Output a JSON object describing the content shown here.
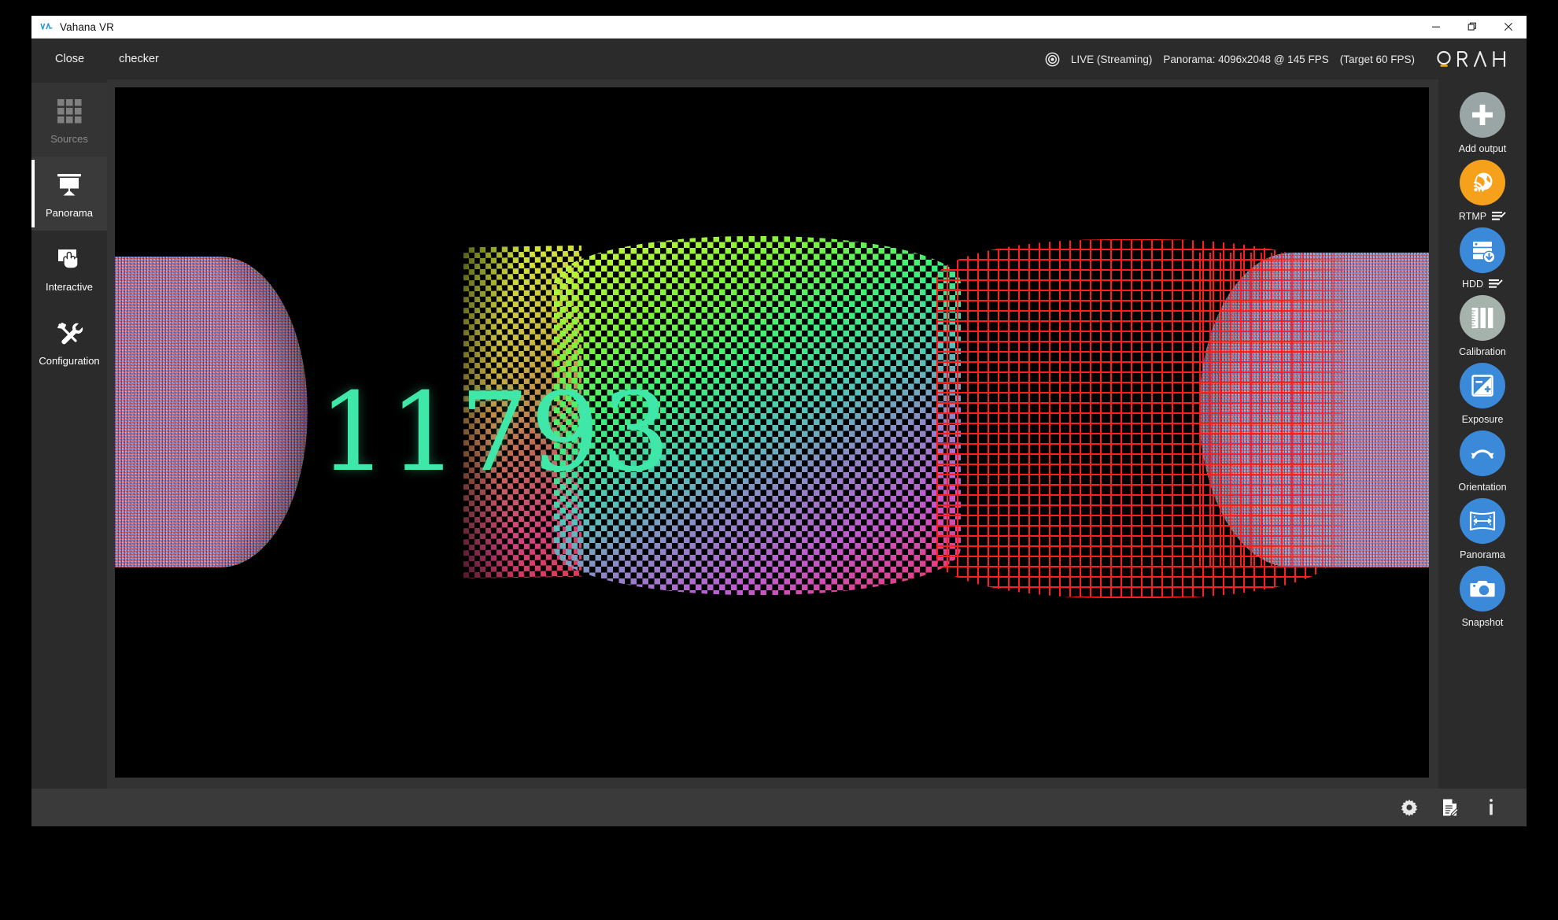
{
  "window": {
    "title": "Vahana VR",
    "logo_icon": "vahana-logo-icon",
    "controls": {
      "minimize": "minimize-icon",
      "restore": "restore-icon",
      "close": "close-icon"
    }
  },
  "header": {
    "close_label": "Close",
    "project_name": "checker",
    "record_icon": "record-target-icon",
    "live_status": "LIVE (Streaming)",
    "panorama_info": "Panorama: 4096x2048 @  145 FPS",
    "target_fps": "(Target 60 FPS)",
    "brand": "ORAH"
  },
  "sidebar": {
    "items": [
      {
        "label": "Sources",
        "icon": "grid-icon",
        "state": "inactive"
      },
      {
        "label": "Panorama",
        "icon": "projector-icon",
        "state": "active"
      },
      {
        "label": "Interactive",
        "icon": "hand-screen-icon",
        "state": "normal"
      },
      {
        "label": "Configuration",
        "icon": "tools-icon",
        "state": "normal"
      }
    ]
  },
  "outputs": {
    "items": [
      {
        "label": "Add output",
        "icon": "plus-icon",
        "color": "#9aa6a6",
        "has_edit": false
      },
      {
        "label": "RTMP",
        "icon": "globe-rss-icon",
        "color": "#f5a11b",
        "has_edit": true
      },
      {
        "label": "HDD",
        "icon": "server-download-icon",
        "color": "#3b8ad9",
        "has_edit": true
      },
      {
        "label": "Calibration",
        "icon": "ruler-icon",
        "color": "#a6b3ac",
        "has_edit": false
      },
      {
        "label": "Exposure",
        "icon": "exposure-icon",
        "color": "#3b8ad9",
        "has_edit": false
      },
      {
        "label": "Orientation",
        "icon": "rotate-arc-icon",
        "color": "#3b8ad9",
        "has_edit": false
      },
      {
        "label": "Panorama",
        "icon": "panorama-icon",
        "color": "#3b8ad9",
        "has_edit": false
      },
      {
        "label": "Snapshot",
        "icon": "camera-icon",
        "color": "#3b8ad9",
        "has_edit": false
      }
    ]
  },
  "viewport": {
    "overlay_number": "11793",
    "overlay_color": "#3fe8a8",
    "background": "#000000"
  },
  "bottom_bar": {
    "icons": [
      {
        "name": "settings-gear-icon"
      },
      {
        "name": "log-document-icon"
      },
      {
        "name": "info-icon"
      }
    ]
  },
  "colors": {
    "app_background": "#2b2b2b",
    "panel_background": "#333333",
    "bottom_bar": "#3a3a3a",
    "accent_blue": "#3b8ad9",
    "accent_orange": "#f5a11b",
    "grid_red": "#ff1d1d"
  }
}
